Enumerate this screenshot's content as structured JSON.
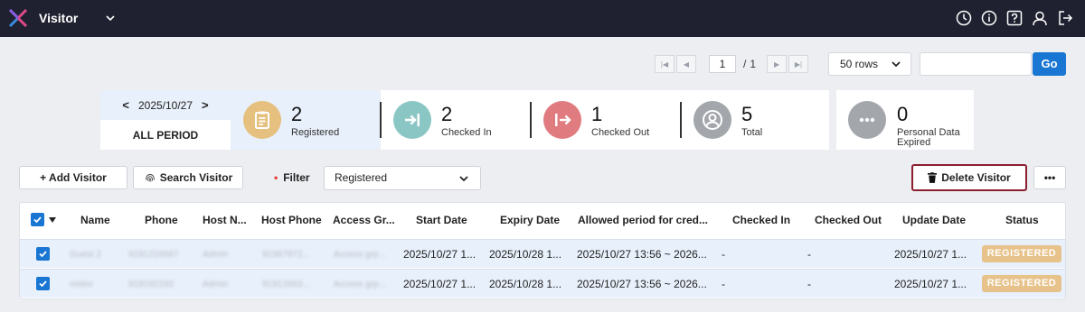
{
  "app": {
    "title": "Visitor"
  },
  "colors": {
    "accent": "#1976d2",
    "topbar": "#1f2130",
    "registered": "#e5c07f",
    "checked_in": "#8ac7c4",
    "checked_out": "#e07b7f",
    "total": "#a3a6ab",
    "badge": "#e7c28a",
    "delete_border": "#8b1e2f"
  },
  "top_icons": [
    "clock-icon",
    "info-icon",
    "help-icon",
    "user-icon",
    "logout-icon"
  ],
  "pager": {
    "current_page": "1",
    "separator": "/",
    "total_pages": "1"
  },
  "rows_select": {
    "value": "50 rows"
  },
  "search": {
    "value": "",
    "go_label": "Go"
  },
  "date_card": {
    "date": "2025/10/27",
    "prev": "<",
    "next": ">",
    "all_period": "ALL PERIOD"
  },
  "stats": [
    {
      "count": "2",
      "label": "Registered",
      "icon": "clipboard-icon"
    },
    {
      "count": "2",
      "label": "Checked In",
      "icon": "check-in-icon"
    },
    {
      "count": "1",
      "label": "Checked Out",
      "icon": "check-out-icon"
    },
    {
      "count": "5",
      "label": "Total",
      "icon": "person-icon"
    }
  ],
  "personal_data": {
    "count": "0",
    "label1": "Personal Data",
    "label2": "Expired",
    "icon": "more-icon"
  },
  "actions": {
    "add_visitor": "+ Add Visitor",
    "search_visitor": "Search Visitor",
    "filter_label": "Filter",
    "filter_value": "Registered",
    "delete_visitor": "Delete Visitor",
    "more": "•••"
  },
  "table": {
    "headers": [
      "Name",
      "Phone",
      "Host N...",
      "Host Phone",
      "Access Gr...",
      "Start Date",
      "Expiry Date",
      "Allowed period for cred...",
      "Checked In",
      "Checked Out",
      "Update Date",
      "Status"
    ],
    "rows": [
      {
        "name": "Guest 2",
        "phone": "9191224567",
        "host": "Admin",
        "host_phone": "91987972...",
        "access": "Access grp...",
        "start": "2025/10/27 1...",
        "expiry": "2025/10/28 1...",
        "allowed": "2025/10/27 13:56 ~ 2026...",
        "checked_in": "-",
        "checked_out": "-",
        "update": "2025/10/27 1...",
        "status": "REGISTERED"
      },
      {
        "name": "visitor",
        "phone": "919192192",
        "host": "Admin",
        "host_phone": "91912663...",
        "access": "Access grp...",
        "start": "2025/10/27 1...",
        "expiry": "2025/10/28 1...",
        "allowed": "2025/10/27 13:56 ~ 2026...",
        "checked_in": "-",
        "checked_out": "-",
        "update": "2025/10/27 1...",
        "status": "REGISTERED"
      }
    ]
  }
}
